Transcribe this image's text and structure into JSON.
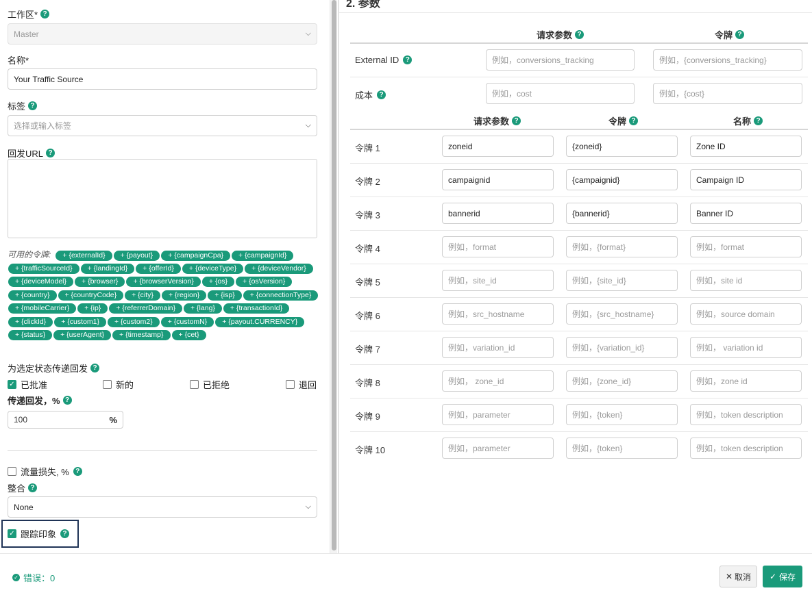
{
  "left": {
    "workspace": {
      "label": "工作区*",
      "value": "Master"
    },
    "name": {
      "label": "名称*",
      "value": "Your Traffic Source"
    },
    "tags": {
      "label": "标签",
      "placeholder": "选择或输入标签"
    },
    "postback_url": {
      "label": "回发URL"
    },
    "tokens_title": "可用的令牌:",
    "tokens": [
      "+ {externalId}",
      "+ {payout}",
      "+ {campaignCpa}",
      "+ {campaignId}",
      "+ {trafficSourceId}",
      "+ {landingId}",
      "+ {offerId}",
      "+ {deviceType}",
      "+ {deviceVendor}",
      "+ {deviceModel}",
      "+ {browser}",
      "+ {browserVersion}",
      "+ {os}",
      "+ {osVersion}",
      "+ {country}",
      "+ {countryCode}",
      "+ {city}",
      "+ {region}",
      "+ {isp}",
      "+ {connectionType}",
      "+ {mobileCarrier}",
      "+ {ip}",
      "+ {referrerDomain}",
      "+ {lang}",
      "+ {transactionId}",
      "+ {clickId}",
      "+ {custom1}",
      "+ {custom2}",
      "+ {customN}",
      "+ {payout.CURRENCY}",
      "+ {status}",
      "+ {userAgent}",
      "+ {timestamp}",
      "+ {cet}"
    ],
    "status_section": {
      "label": "为选定状态传递回发"
    },
    "statuses": [
      {
        "label": "已批准",
        "checked": true
      },
      {
        "label": "新的",
        "checked": false
      },
      {
        "label": "已拒绝",
        "checked": false
      },
      {
        "label": "退回",
        "checked": false
      }
    ],
    "pass_percent": {
      "label": "传递回发，%",
      "value": "100",
      "suffix": "%"
    },
    "traffic_loss": {
      "label": "流量损失, %",
      "checked": false
    },
    "integration": {
      "label": "整合",
      "value": "None"
    },
    "track_impressions": {
      "label": "跟踪印象",
      "checked": true
    }
  },
  "right": {
    "title": "2. 参数",
    "top_headers": {
      "param": "请求参数",
      "token": "令牌"
    },
    "top_rows": [
      {
        "label": "External ID",
        "param_ph": "例如，conversions_tracking",
        "token_ph": "例如，{conversions_tracking}"
      },
      {
        "label": "成本",
        "param_ph": "例如，cost",
        "token_ph": "例如，{cost}"
      }
    ],
    "headers": {
      "param": "请求参数",
      "token": "令牌",
      "name": "名称"
    },
    "rows": [
      {
        "label": "令牌 1",
        "param": "zoneid",
        "token": "{zoneid}",
        "name": "Zone ID",
        "filled": true
      },
      {
        "label": "令牌 2",
        "param": "campaignid",
        "token": "{campaignid}",
        "name": "Campaign ID",
        "filled": true
      },
      {
        "label": "令牌 3",
        "param": "bannerid",
        "token": "{bannerid}",
        "name": "Banner ID",
        "filled": true
      },
      {
        "label": "令牌 4",
        "param": "例如，format",
        "token": "例如，{format}",
        "name": "例如，format",
        "filled": false
      },
      {
        "label": "令牌 5",
        "param": "例如，site_id",
        "token": "例如，{site_id}",
        "name": "例如，site id",
        "filled": false
      },
      {
        "label": "令牌 6",
        "param": "例如，src_hostname",
        "token": "例如，{src_hostname}",
        "name": "例如，source domain",
        "filled": false
      },
      {
        "label": "令牌 7",
        "param": "例如，variation_id",
        "token": "例如，{variation_id}",
        "name": "例如， variation id",
        "filled": false
      },
      {
        "label": "令牌 8",
        "param": "例如， zone_id",
        "token": "例如，{zone_id}",
        "name": "例如，zone id",
        "filled": false
      },
      {
        "label": "令牌 9",
        "param": "例如，parameter",
        "token": "例如，{token}",
        "name": "例如，token description",
        "filled": false
      },
      {
        "label": "令牌 10",
        "param": "例如，parameter",
        "token": "例如，{token}",
        "name": "例如，token description",
        "filled": false
      }
    ]
  },
  "footer": {
    "errors": "错误：0",
    "cancel": "取消",
    "save": "保存"
  },
  "colors": {
    "accent": "#1a9a7a",
    "focus": "#1f3356"
  }
}
